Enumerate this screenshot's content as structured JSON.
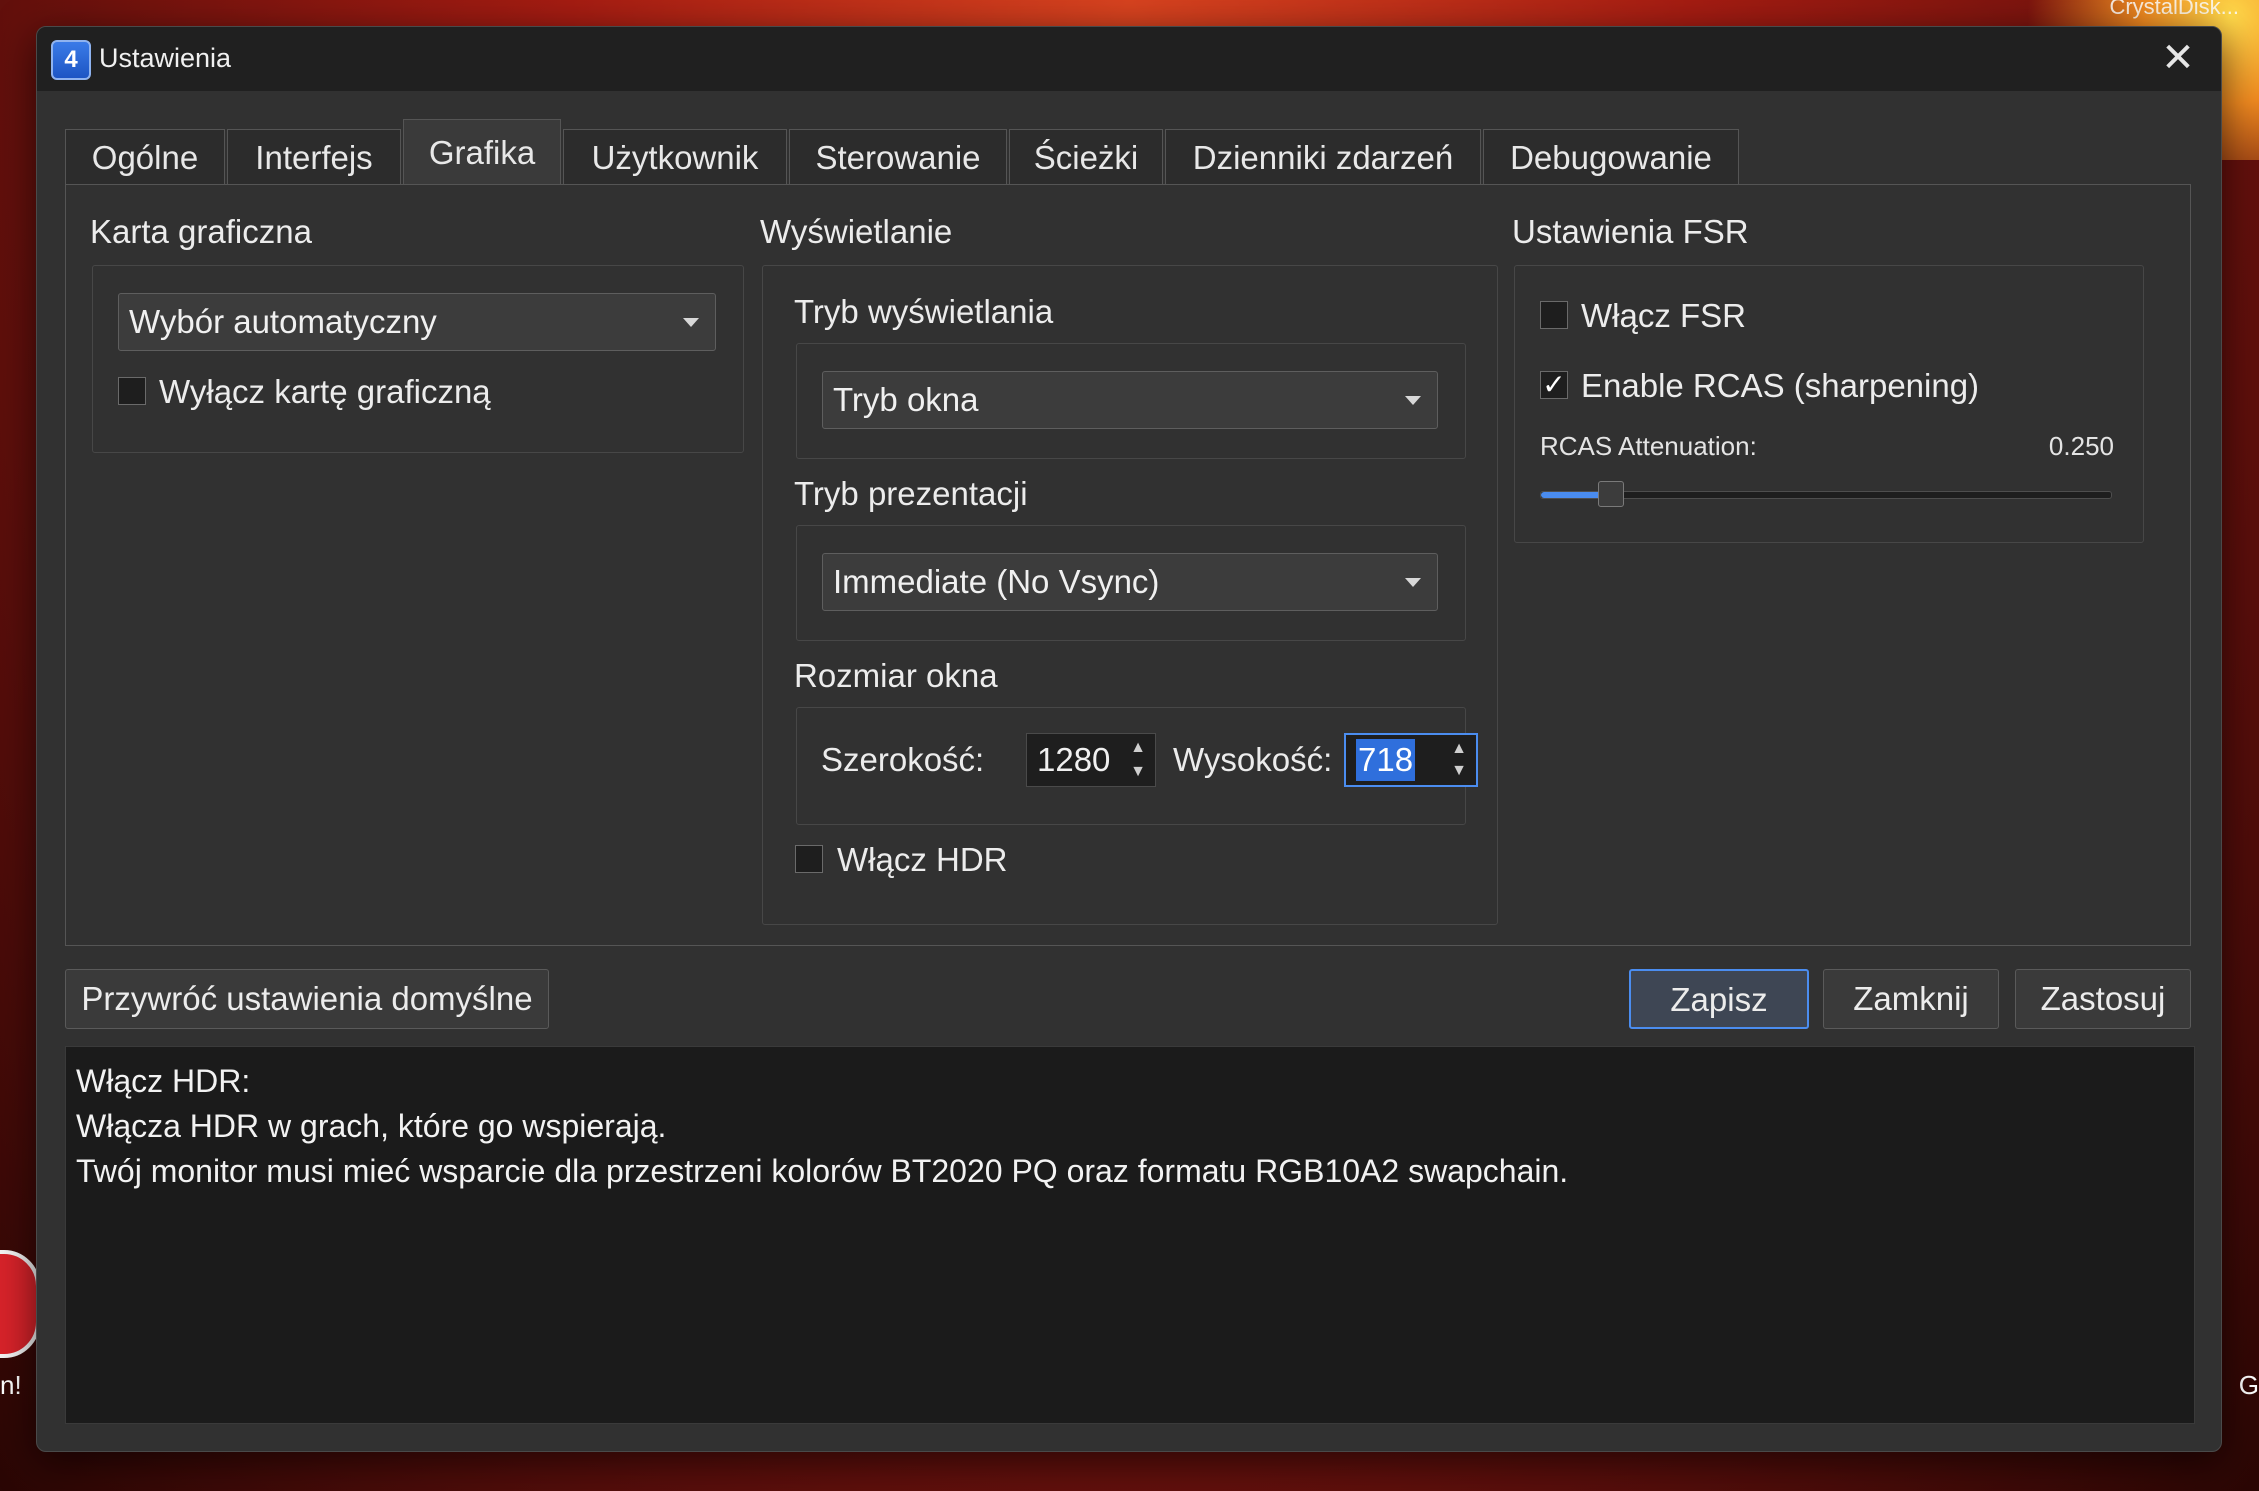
{
  "window": {
    "title": "Ustawienia",
    "close_glyph": "✕",
    "app_icon_text": "4"
  },
  "desktop": {
    "top_right_label": "CrystalDisk...",
    "left_label": "n!",
    "right_label": "G"
  },
  "tabs": [
    {
      "label": "Ogólne"
    },
    {
      "label": "Interfejs"
    },
    {
      "label": "Grafika",
      "active": true
    },
    {
      "label": "Użytkownik"
    },
    {
      "label": "Sterowanie"
    },
    {
      "label": "Ścieżki"
    },
    {
      "label": "Dzienniki zdarzeń"
    },
    {
      "label": "Debugowanie"
    }
  ],
  "gpu": {
    "title": "Karta graficzna",
    "device_combo": "Wybór automatyczny",
    "disable_label": "Wyłącz kartę graficzną",
    "disable_checked": false
  },
  "display": {
    "title": "Wyświetlanie",
    "mode_label": "Tryb wyświetlania",
    "mode_value": "Tryb okna",
    "present_label": "Tryb prezentacji",
    "present_value": "Immediate (No Vsync)",
    "size_label": "Rozmiar okna",
    "width_label": "Szerokość:",
    "width_value": "1280",
    "height_label": "Wysokość:",
    "height_value": "718",
    "hdr_label": "Włącz HDR",
    "hdr_checked": false
  },
  "fsr": {
    "title": "Ustawienia FSR",
    "enable_label": "Włącz FSR",
    "enable_checked": false,
    "rcas_label": "Enable RCAS (sharpening)",
    "rcas_checked": true,
    "rcas_check_glyph": "✓",
    "attenuation_label": "RCAS Attenuation:",
    "attenuation_value": "0.250",
    "attenuation_fraction": 0.1
  },
  "buttons": {
    "restore": "Przywróć ustawienia domyślne",
    "save": "Zapisz",
    "close": "Zamknij",
    "apply": "Zastosuj"
  },
  "description": {
    "line1": "Włącz HDR:",
    "line2": "Włącza HDR w grach, które go wspierają.",
    "line3": "Twój monitor musi mieć wsparcie dla przestrzeni kolorów BT2020 PQ oraz formatu RGB10A2 swapchain."
  },
  "colors": {
    "accent": "#4b8df0",
    "window_bg": "#313131",
    "titlebar_bg": "#202020",
    "description_bg": "#1b1b1b"
  },
  "icons": {
    "close": "close-icon",
    "dropdown": "chevron-down-icon",
    "spin_up": "spin-up-icon",
    "spin_down": "spin-down-icon"
  }
}
